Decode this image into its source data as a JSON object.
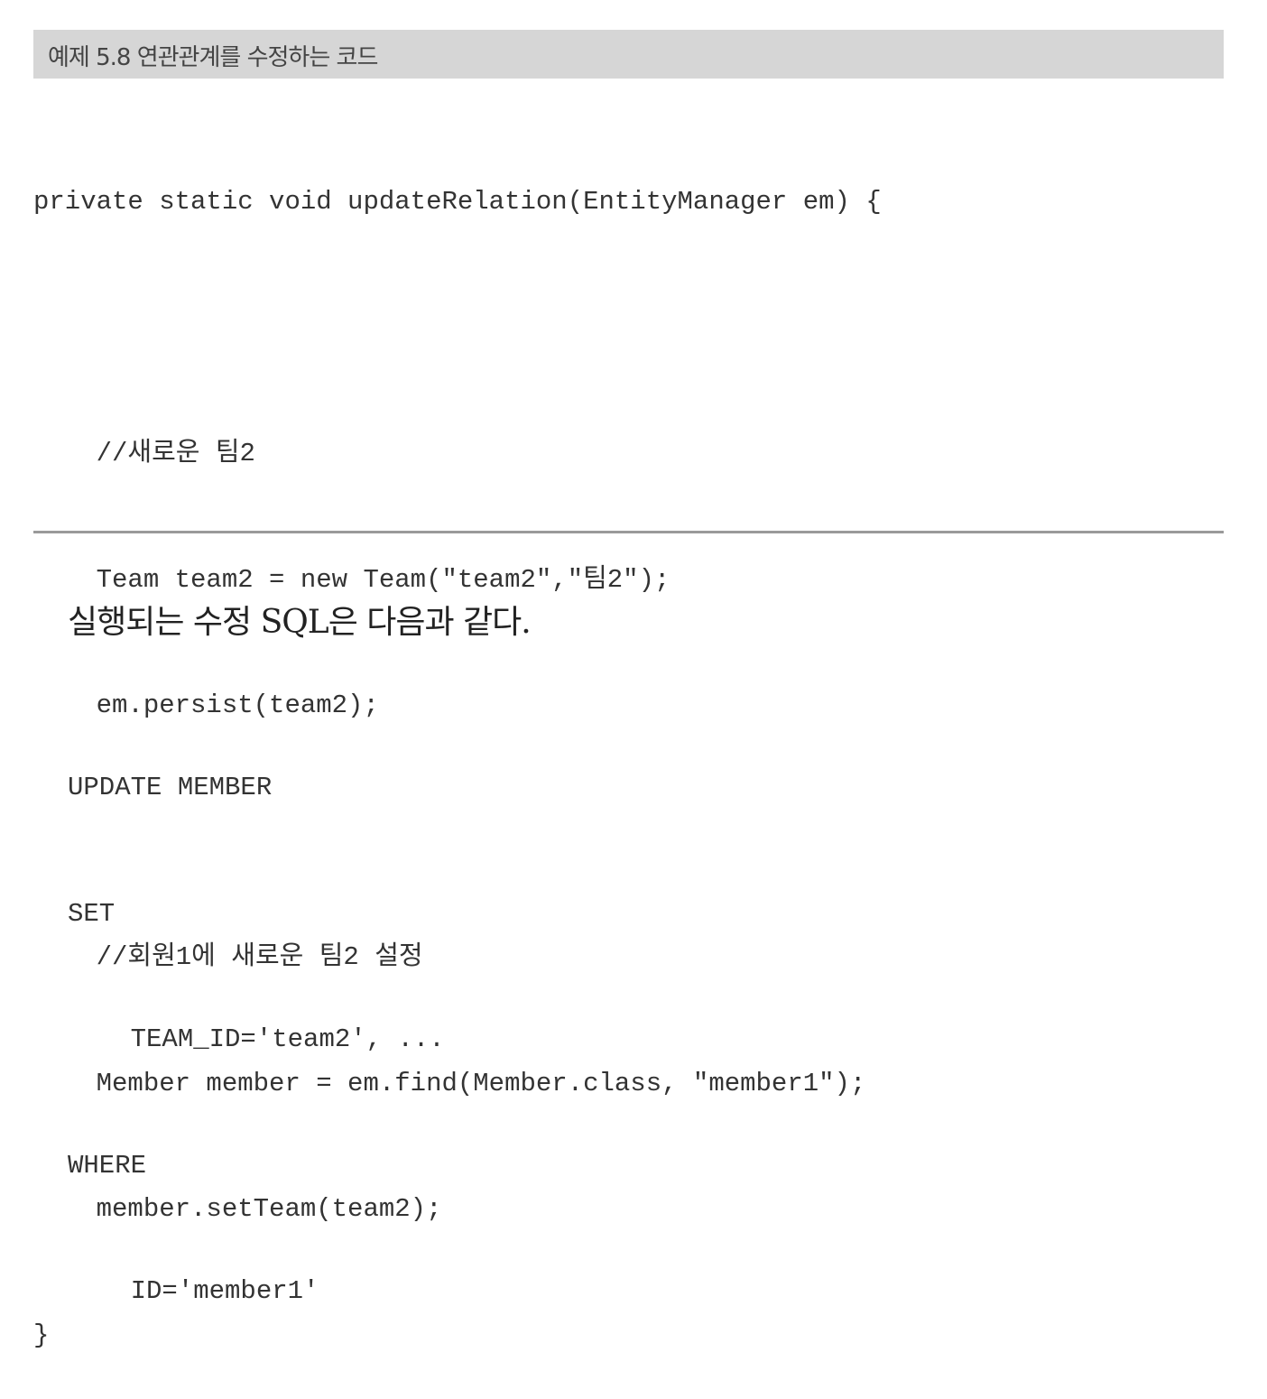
{
  "caption": "예제 5.8  연관관계를 수정하는 코드",
  "code_lines": [
    "private static void updateRelation(EntityManager em) {",
    "",
    "    //새로운 팀2",
    "    Team team2 = new Team(\"team2\",\"팀2\");",
    "    em.persist(team2);",
    "",
    "    //회원1에 새로운 팀2 설정",
    "    Member member = em.find(Member.class, \"member1\");",
    "    member.setTeam(team2);",
    "}"
  ],
  "paragraph": "실행되는 수정 SQL은 다음과 같다.",
  "sql_lines": [
    "UPDATE MEMBER",
    "SET",
    "    TEAM_ID='team2', ...",
    "WHERE",
    "    ID='member1'"
  ]
}
